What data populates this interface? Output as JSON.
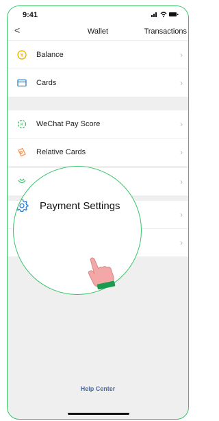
{
  "status": {
    "time": "9:41"
  },
  "nav": {
    "back": "<",
    "title": "Wallet",
    "transactions": "Transactions"
  },
  "groups": [
    {
      "rows": [
        {
          "label": "Balance",
          "icon": "balance-icon"
        },
        {
          "label": "Cards",
          "icon": "cards-icon"
        }
      ]
    },
    {
      "rows": [
        {
          "label": "WeChat Pay Score",
          "icon": "pay-score-icon"
        },
        {
          "label": "Relative Cards",
          "icon": "relative-cards-icon"
        }
      ]
    },
    {
      "rows": [
        {
          "label": "",
          "icon": "gift-icon"
        }
      ]
    },
    {
      "rows": [
        {
          "label": "",
          "icon": ""
        },
        {
          "label": "",
          "icon": ""
        }
      ]
    }
  ],
  "magnified": {
    "label": "Payment Settings",
    "icon": "gear-icon"
  },
  "help_center": "Help Center",
  "colors": {
    "accent": "#39c46a",
    "link": "#4b6aa6",
    "balance": "#f4b400",
    "cards": "#2d7fd3"
  }
}
